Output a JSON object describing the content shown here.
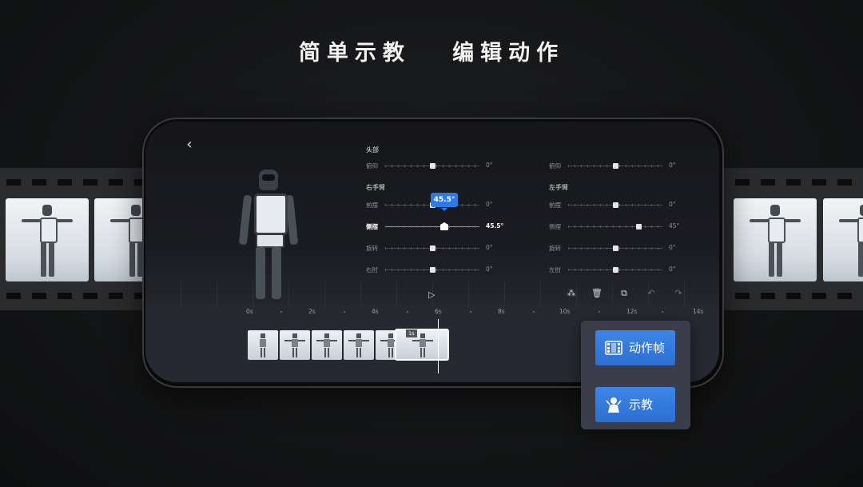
{
  "headline": "简单示教   编辑动作",
  "controls": {
    "head": {
      "title": "头部",
      "rows": [
        {
          "label": "俯仰",
          "value": "0°"
        }
      ]
    },
    "right_arm": {
      "title": "右手臂",
      "rows": [
        {
          "label": "前摆",
          "value": "0°"
        },
        {
          "label": "侧摆",
          "value": "45.5°"
        },
        {
          "label": "旋转",
          "value": "0°"
        },
        {
          "label": "右肘",
          "value": "0°"
        }
      ],
      "tooltip": "45.5°"
    },
    "top_right": {
      "rows": [
        {
          "label": "俯仰",
          "value": "0°"
        }
      ]
    },
    "left_arm": {
      "title": "左手臂",
      "rows": [
        {
          "label": "前摆",
          "value": "0°"
        },
        {
          "label": "侧摆",
          "value": "45°"
        },
        {
          "label": "旋转",
          "value": "0°"
        },
        {
          "label": "左肘",
          "value": "0°"
        }
      ]
    }
  },
  "toolbar": {
    "icons": [
      "play-icon",
      "group-icon",
      "trash-icon",
      "copy-icon",
      "undo-icon",
      "redo-icon"
    ]
  },
  "timeline": {
    "ticks": [
      "0s",
      "2s",
      "4s",
      "6s",
      "8s",
      "10s",
      "12s",
      "14s"
    ],
    "selected_clip_badge": "1s"
  },
  "popover": {
    "keyframe_label": "动作帧",
    "teach_label": "示教"
  },
  "colors": {
    "accent": "#2f7be6",
    "background": "#141516",
    "popover": "#3b3d4a"
  }
}
